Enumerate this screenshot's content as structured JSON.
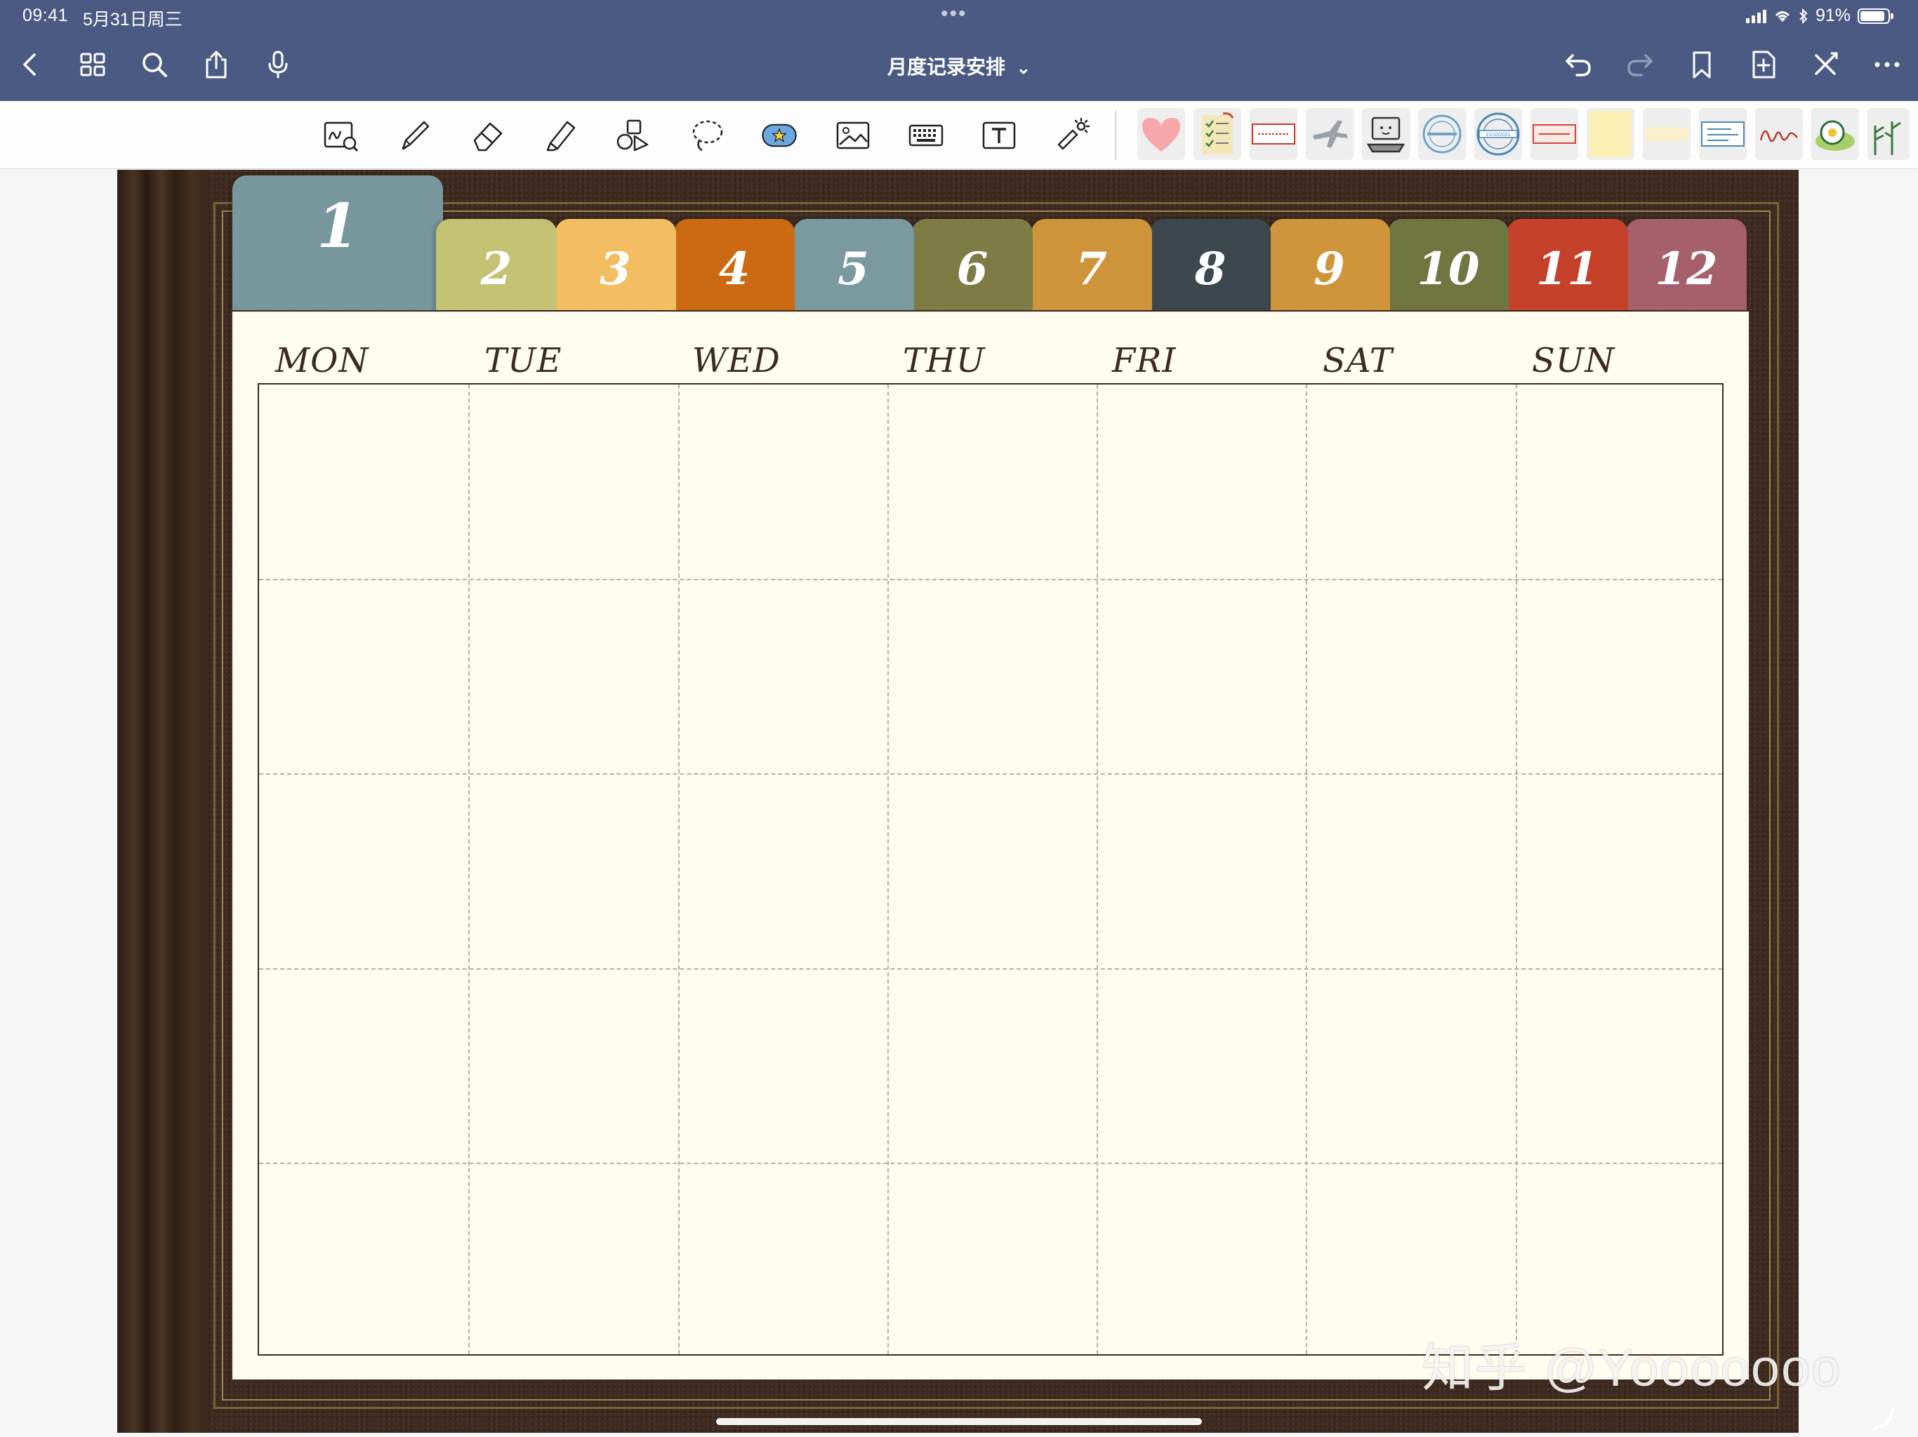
{
  "status_bar": {
    "time": "09:41",
    "date": "5月31日周三",
    "more_dots": "•••",
    "battery_percent": "91%",
    "battery_level": 0.91
  },
  "nav": {
    "title": "月度记录安排",
    "title_chevron": "⌄",
    "left_icons": [
      "back-icon",
      "grid-icon",
      "search-icon",
      "share-icon",
      "microphone-icon"
    ],
    "right_icons": [
      "undo-icon",
      "redo-icon",
      "bookmark-icon",
      "add-page-icon",
      "close-icon",
      "more-icon"
    ]
  },
  "toolbar": {
    "tools": [
      "zoom-window-icon",
      "pen-icon",
      "eraser-icon",
      "highlighter-icon",
      "shapes-icon",
      "lasso-icon",
      "elements-icon",
      "image-icon",
      "keyboard-icon",
      "text-box-icon",
      "laser-pointer-icon"
    ],
    "selected_tool": "elements-icon",
    "stickers": [
      "heart-sticker",
      "checklist-sticker",
      "ticket-sticker",
      "airplane-sticker",
      "laptop-sticker",
      "round-stamp-sticker",
      "date-stamp-sticker",
      "label-sticker",
      "sticky-note-sticker",
      "tape-sticker",
      "boarding-pass-sticker",
      "signature-sticker",
      "flower-sticker",
      "plant-sticker"
    ],
    "stamp_date_text": "21/10/2021"
  },
  "calendar": {
    "months": [
      "1",
      "2",
      "3",
      "4",
      "5",
      "6",
      "7",
      "8",
      "9",
      "10",
      "11",
      "12"
    ],
    "active_month": "1",
    "tab_colors": [
      "#78979d",
      "#c4c273",
      "#f3be62",
      "#cb6a13",
      "#7b9aa0",
      "#7c7c44",
      "#cd943a",
      "#3c484d",
      "#cf953b",
      "#717641",
      "#c64129",
      "#a5606c"
    ],
    "weekdays": [
      "MON",
      "TUE",
      "WED",
      "THU",
      "FRI",
      "SAT",
      "SUN"
    ],
    "rows": 5
  },
  "watermark": "知乎 @Yooooooo",
  "colors": {
    "nav_bg": "#4a5a82",
    "paper": "#fffcf0",
    "leather": "#3e2a1f"
  }
}
